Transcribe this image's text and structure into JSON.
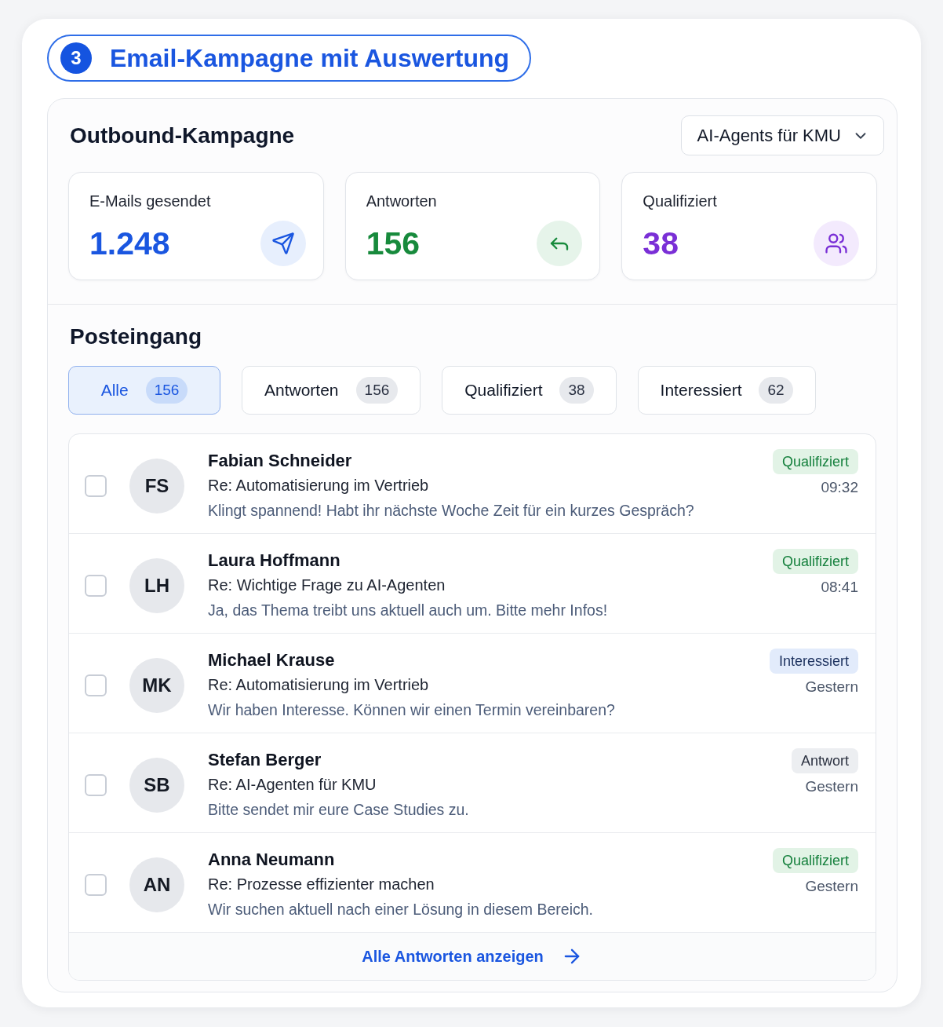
{
  "section": {
    "number": "3",
    "title": "Email-Kampagne mit Auswertung"
  },
  "campaign": {
    "title": "Outbound-Kampagne",
    "selector": {
      "value": "AI-Agents für KMU"
    }
  },
  "stats": [
    {
      "kind": "sent",
      "label": "E-Mails gesendet",
      "value": "1.248"
    },
    {
      "kind": "replies",
      "label": "Antworten",
      "value": "156"
    },
    {
      "kind": "qualified",
      "label": "Qualifiziert",
      "value": "38"
    }
  ],
  "inbox": {
    "title": "Posteingang",
    "tabs": [
      {
        "label": "Alle",
        "count": "156",
        "selected": true
      },
      {
        "label": "Antworten",
        "count": "156",
        "selected": false
      },
      {
        "label": "Qualifiziert",
        "count": "38",
        "selected": false
      },
      {
        "label": "Interessiert",
        "count": "62",
        "selected": false
      }
    ],
    "messages": [
      {
        "checked": false,
        "initials": "FS",
        "name": "Fabian Schneider",
        "subject": "Re: Automatisierung im Vertrieb",
        "preview": "Klingt spannend! Habt ihr nächste Woche Zeit für ein kurzes Gespräch?",
        "status": {
          "kind": "qualified",
          "label": "Qualifiziert"
        },
        "time": "09:32"
      },
      {
        "checked": false,
        "initials": "LH",
        "name": "Laura Hoffmann",
        "subject": "Re: Wichtige Frage zu AI-Agenten",
        "preview": "Ja, das Thema treibt uns aktuell auch um. Bitte mehr Infos!",
        "status": {
          "kind": "qualified",
          "label": "Qualifiziert"
        },
        "time": "08:41"
      },
      {
        "checked": false,
        "initials": "MK",
        "name": "Michael Krause",
        "subject": "Re: Automatisierung im Vertrieb",
        "preview": "Wir haben Interesse. Können wir einen Termin vereinbaren?",
        "status": {
          "kind": "interested",
          "label": "Interessiert"
        },
        "time": "Gestern"
      },
      {
        "checked": false,
        "initials": "SB",
        "name": "Stefan Berger",
        "subject": "Re: AI-Agenten für KMU",
        "preview": "Bitte sendet mir eure Case Studies zu.",
        "status": {
          "kind": "reply",
          "label": "Antwort"
        },
        "time": "Gestern"
      },
      {
        "checked": false,
        "initials": "AN",
        "name": "Anna Neumann",
        "subject": "Re: Prozesse effizienter machen",
        "preview": "Wir suchen aktuell nach einer Lösung in diesem Bereich.",
        "status": {
          "kind": "qualified",
          "label": "Qualifiziert"
        },
        "time": "Gestern"
      }
    ],
    "footer_link": "Alle Antworten anzeigen"
  }
}
